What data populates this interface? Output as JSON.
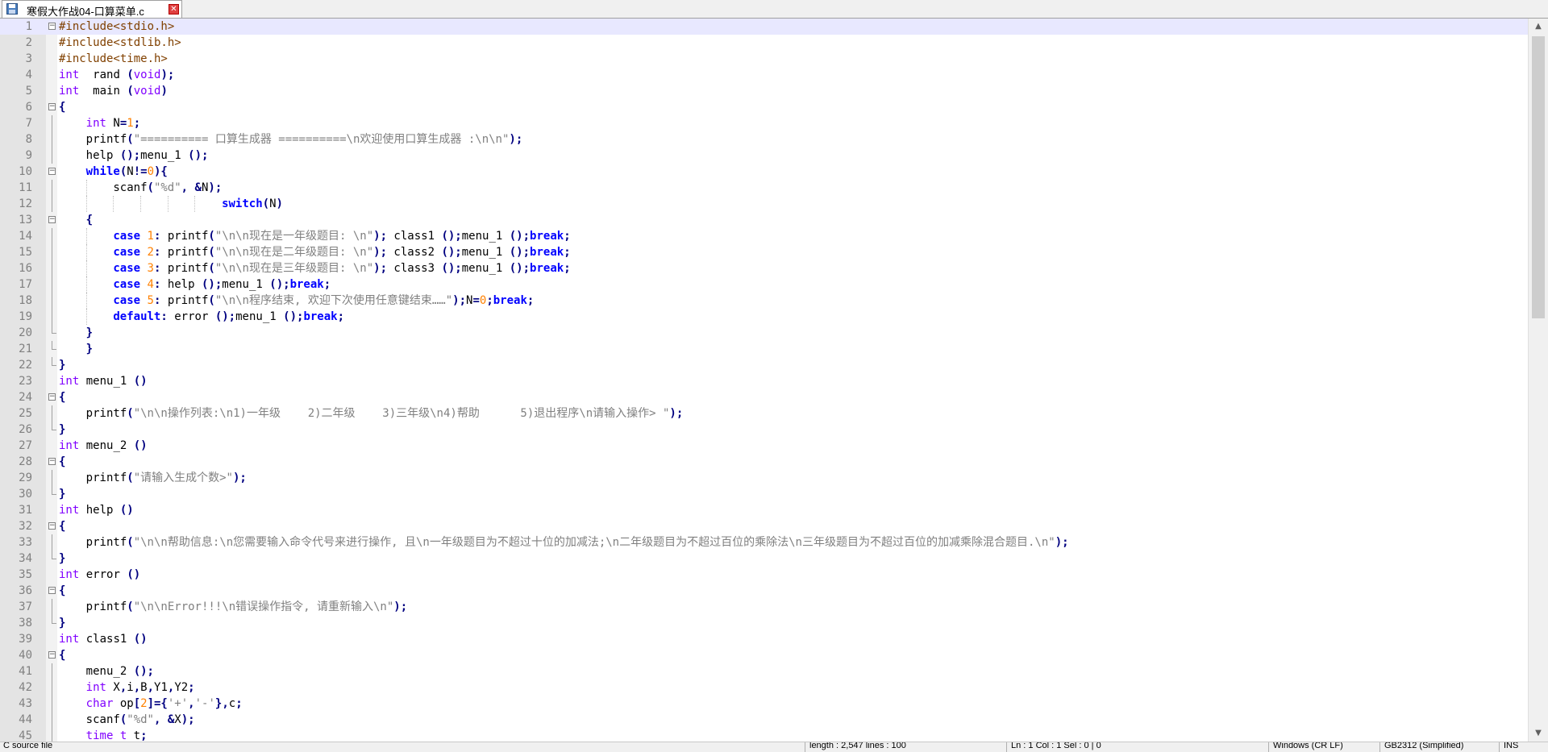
{
  "tab": {
    "title": "寒假大作战04-口算菜单.c",
    "save_icon": "floppy-disk-icon",
    "close_icon": "close-icon",
    "close_glyph": "✕"
  },
  "editor": {
    "current_line": 1,
    "lines": [
      {
        "n": "1",
        "indent": 0,
        "fold": "box",
        "foldFlow": "",
        "segs": [
          [
            "pp",
            "#include<stdio.h>"
          ]
        ]
      },
      {
        "n": "2",
        "indent": 0,
        "fold": "",
        "foldFlow": "",
        "segs": [
          [
            "pp",
            "#include<stdlib.h>"
          ]
        ]
      },
      {
        "n": "3",
        "indent": 0,
        "fold": "",
        "foldFlow": "",
        "segs": [
          [
            "pp",
            "#include<time.h>"
          ]
        ]
      },
      {
        "n": "4",
        "indent": 0,
        "fold": "",
        "foldFlow": "",
        "segs": [
          [
            "ty",
            "int"
          ],
          [
            "",
            "  rand "
          ],
          [
            "op",
            "("
          ],
          [
            "ty",
            "void"
          ],
          [
            "op",
            ");"
          ]
        ]
      },
      {
        "n": "5",
        "indent": 0,
        "fold": "",
        "foldFlow": "",
        "segs": [
          [
            "ty",
            "int"
          ],
          [
            "",
            "  main "
          ],
          [
            "op",
            "("
          ],
          [
            "ty",
            "void"
          ],
          [
            "op",
            ")"
          ]
        ]
      },
      {
        "n": "6",
        "indent": 0,
        "fold": "box",
        "foldFlow": "",
        "segs": [
          [
            "op",
            "{"
          ]
        ]
      },
      {
        "n": "7",
        "indent": 1,
        "fold": "",
        "foldFlow": "v",
        "segs": [
          [
            "ty",
            "int"
          ],
          [
            "",
            " N"
          ],
          [
            "op",
            "="
          ],
          [
            "nm",
            "1"
          ],
          [
            "op",
            ";"
          ]
        ]
      },
      {
        "n": "8",
        "indent": 1,
        "fold": "",
        "foldFlow": "v",
        "segs": [
          [
            "",
            "printf"
          ],
          [
            "op",
            "("
          ],
          [
            "st",
            "\"========== 口算生成器 ==========\\n欢迎使用口算生成器 :\\n\\n\""
          ],
          [
            "op",
            ");"
          ]
        ]
      },
      {
        "n": "9",
        "indent": 1,
        "fold": "",
        "foldFlow": "v",
        "segs": [
          [
            "",
            "help "
          ],
          [
            "op",
            "();"
          ],
          [
            "",
            "menu_1 "
          ],
          [
            "op",
            "();"
          ]
        ]
      },
      {
        "n": "10",
        "indent": 1,
        "fold": "box",
        "foldFlow": "",
        "segs": [
          [
            "kw",
            "while"
          ],
          [
            "op",
            "("
          ],
          [
            "",
            "N"
          ],
          [
            "op",
            "!="
          ],
          [
            "nm",
            "0"
          ],
          [
            "op",
            "){"
          ]
        ]
      },
      {
        "n": "11",
        "indent": 2,
        "fold": "",
        "foldFlow": "v",
        "segs": [
          [
            "",
            "scanf"
          ],
          [
            "op",
            "("
          ],
          [
            "st",
            "\"%d\""
          ],
          [
            "op",
            ", &"
          ],
          [
            "",
            "N"
          ],
          [
            "op",
            ");"
          ]
        ]
      },
      {
        "n": "12",
        "indent": 6,
        "fold": "",
        "foldFlow": "v",
        "segs": [
          [
            "kw",
            "switch"
          ],
          [
            "op",
            "("
          ],
          [
            "",
            "N"
          ],
          [
            "op",
            ")"
          ]
        ]
      },
      {
        "n": "13",
        "indent": 1,
        "fold": "box",
        "foldFlow": "",
        "segs": [
          [
            "op",
            "{"
          ]
        ]
      },
      {
        "n": "14",
        "indent": 2,
        "fold": "",
        "foldFlow": "v",
        "segs": [
          [
            "kw",
            "case"
          ],
          [
            "",
            " "
          ],
          [
            "nm",
            "1"
          ],
          [
            "op",
            ":"
          ],
          [
            "",
            " printf"
          ],
          [
            "op",
            "("
          ],
          [
            "st",
            "\"\\n\\n现在是一年级题目: \\n\""
          ],
          [
            "op",
            ");"
          ],
          [
            "",
            " class1 "
          ],
          [
            "op",
            "();"
          ],
          [
            "",
            "menu_1 "
          ],
          [
            "op",
            "();"
          ],
          [
            "kw",
            "break"
          ],
          [
            "op",
            ";"
          ]
        ]
      },
      {
        "n": "15",
        "indent": 2,
        "fold": "",
        "foldFlow": "v",
        "segs": [
          [
            "kw",
            "case"
          ],
          [
            "",
            " "
          ],
          [
            "nm",
            "2"
          ],
          [
            "op",
            ":"
          ],
          [
            "",
            " printf"
          ],
          [
            "op",
            "("
          ],
          [
            "st",
            "\"\\n\\n现在是二年级题目: \\n\""
          ],
          [
            "op",
            ");"
          ],
          [
            "",
            " class2 "
          ],
          [
            "op",
            "();"
          ],
          [
            "",
            "menu_1 "
          ],
          [
            "op",
            "();"
          ],
          [
            "kw",
            "break"
          ],
          [
            "op",
            ";"
          ]
        ]
      },
      {
        "n": "16",
        "indent": 2,
        "fold": "",
        "foldFlow": "v",
        "segs": [
          [
            "kw",
            "case"
          ],
          [
            "",
            " "
          ],
          [
            "nm",
            "3"
          ],
          [
            "op",
            ":"
          ],
          [
            "",
            " printf"
          ],
          [
            "op",
            "("
          ],
          [
            "st",
            "\"\\n\\n现在是三年级题目: \\n\""
          ],
          [
            "op",
            ");"
          ],
          [
            "",
            " class3 "
          ],
          [
            "op",
            "();"
          ],
          [
            "",
            "menu_1 "
          ],
          [
            "op",
            "();"
          ],
          [
            "kw",
            "break"
          ],
          [
            "op",
            ";"
          ]
        ]
      },
      {
        "n": "17",
        "indent": 2,
        "fold": "",
        "foldFlow": "v",
        "segs": [
          [
            "kw",
            "case"
          ],
          [
            "",
            " "
          ],
          [
            "nm",
            "4"
          ],
          [
            "op",
            ":"
          ],
          [
            "",
            " help "
          ],
          [
            "op",
            "();"
          ],
          [
            "",
            "menu_1 "
          ],
          [
            "op",
            "();"
          ],
          [
            "kw",
            "break"
          ],
          [
            "op",
            ";"
          ]
        ]
      },
      {
        "n": "18",
        "indent": 2,
        "fold": "",
        "foldFlow": "v",
        "segs": [
          [
            "kw",
            "case"
          ],
          [
            "",
            " "
          ],
          [
            "nm",
            "5"
          ],
          [
            "op",
            ":"
          ],
          [
            "",
            " printf"
          ],
          [
            "op",
            "("
          ],
          [
            "st",
            "\"\\n\\n程序结束, 欢迎下次使用任意键结束……\""
          ],
          [
            "op",
            ");"
          ],
          [
            "",
            "N"
          ],
          [
            "op",
            "="
          ],
          [
            "nm",
            "0"
          ],
          [
            "op",
            ";"
          ],
          [
            "kw",
            "break"
          ],
          [
            "op",
            ";"
          ]
        ]
      },
      {
        "n": "19",
        "indent": 2,
        "fold": "",
        "foldFlow": "v",
        "segs": [
          [
            "kw",
            "default"
          ],
          [
            "op",
            ":"
          ],
          [
            "",
            " error "
          ],
          [
            "op",
            "();"
          ],
          [
            "",
            "menu_1 "
          ],
          [
            "op",
            "();"
          ],
          [
            "kw",
            "break"
          ],
          [
            "op",
            ";"
          ]
        ]
      },
      {
        "n": "20",
        "indent": 1,
        "fold": "",
        "foldFlow": "end",
        "segs": [
          [
            "op",
            "}"
          ]
        ]
      },
      {
        "n": "21",
        "indent": 1,
        "fold": "",
        "foldFlow": "end",
        "segs": [
          [
            "op",
            "}"
          ]
        ]
      },
      {
        "n": "22",
        "indent": 0,
        "fold": "",
        "foldFlow": "end",
        "segs": [
          [
            "op",
            "}"
          ]
        ]
      },
      {
        "n": "23",
        "indent": 0,
        "fold": "",
        "foldFlow": "",
        "segs": [
          [
            "ty",
            "int"
          ],
          [
            "",
            " menu_1 "
          ],
          [
            "op",
            "()"
          ]
        ]
      },
      {
        "n": "24",
        "indent": 0,
        "fold": "box",
        "foldFlow": "",
        "segs": [
          [
            "op",
            "{"
          ]
        ]
      },
      {
        "n": "25",
        "indent": 1,
        "fold": "",
        "foldFlow": "v",
        "segs": [
          [
            "",
            "printf"
          ],
          [
            "op",
            "("
          ],
          [
            "st",
            "\"\\n\\n操作列表:\\n1)一年级    2)二年级    3)三年级\\n4)帮助      5)退出程序\\n请输入操作> \""
          ],
          [
            "op",
            ");"
          ]
        ]
      },
      {
        "n": "26",
        "indent": 0,
        "fold": "",
        "foldFlow": "end",
        "segs": [
          [
            "op",
            "}"
          ]
        ]
      },
      {
        "n": "27",
        "indent": 0,
        "fold": "",
        "foldFlow": "",
        "segs": [
          [
            "ty",
            "int"
          ],
          [
            "",
            " menu_2 "
          ],
          [
            "op",
            "()"
          ]
        ]
      },
      {
        "n": "28",
        "indent": 0,
        "fold": "box",
        "foldFlow": "",
        "segs": [
          [
            "op",
            "{"
          ]
        ]
      },
      {
        "n": "29",
        "indent": 1,
        "fold": "",
        "foldFlow": "v",
        "segs": [
          [
            "",
            "printf"
          ],
          [
            "op",
            "("
          ],
          [
            "st",
            "\"请输入生成个数>\""
          ],
          [
            "op",
            ");"
          ]
        ]
      },
      {
        "n": "30",
        "indent": 0,
        "fold": "",
        "foldFlow": "end",
        "segs": [
          [
            "op",
            "}"
          ]
        ]
      },
      {
        "n": "31",
        "indent": 0,
        "fold": "",
        "foldFlow": "",
        "segs": [
          [
            "ty",
            "int"
          ],
          [
            "",
            " help "
          ],
          [
            "op",
            "()"
          ]
        ]
      },
      {
        "n": "32",
        "indent": 0,
        "fold": "box",
        "foldFlow": "",
        "segs": [
          [
            "op",
            "{"
          ]
        ]
      },
      {
        "n": "33",
        "indent": 1,
        "fold": "",
        "foldFlow": "v",
        "segs": [
          [
            "",
            "printf"
          ],
          [
            "op",
            "("
          ],
          [
            "st",
            "\"\\n\\n帮助信息:\\n您需要输入命令代号来进行操作, 且\\n一年级题目为不超过十位的加减法;\\n二年级题目为不超过百位的乘除法\\n三年级题目为不超过百位的加减乘除混合题目.\\n\""
          ],
          [
            "op",
            ");"
          ]
        ]
      },
      {
        "n": "34",
        "indent": 0,
        "fold": "",
        "foldFlow": "end",
        "segs": [
          [
            "op",
            "}"
          ]
        ]
      },
      {
        "n": "35",
        "indent": 0,
        "fold": "",
        "foldFlow": "",
        "segs": [
          [
            "ty",
            "int"
          ],
          [
            "",
            " error "
          ],
          [
            "op",
            "()"
          ]
        ]
      },
      {
        "n": "36",
        "indent": 0,
        "fold": "box",
        "foldFlow": "",
        "segs": [
          [
            "op",
            "{"
          ]
        ]
      },
      {
        "n": "37",
        "indent": 1,
        "fold": "",
        "foldFlow": "v",
        "segs": [
          [
            "",
            "printf"
          ],
          [
            "op",
            "("
          ],
          [
            "st",
            "\"\\n\\nError!!!\\n错误操作指令, 请重新输入\\n\""
          ],
          [
            "op",
            ");"
          ]
        ]
      },
      {
        "n": "38",
        "indent": 0,
        "fold": "",
        "foldFlow": "end",
        "segs": [
          [
            "op",
            "}"
          ]
        ]
      },
      {
        "n": "39",
        "indent": 0,
        "fold": "",
        "foldFlow": "",
        "segs": [
          [
            "ty",
            "int"
          ],
          [
            "",
            " class1 "
          ],
          [
            "op",
            "()"
          ]
        ]
      },
      {
        "n": "40",
        "indent": 0,
        "fold": "box",
        "foldFlow": "",
        "segs": [
          [
            "op",
            "{"
          ]
        ]
      },
      {
        "n": "41",
        "indent": 1,
        "fold": "",
        "foldFlow": "v",
        "segs": [
          [
            "",
            "menu_2 "
          ],
          [
            "op",
            "();"
          ]
        ]
      },
      {
        "n": "42",
        "indent": 1,
        "fold": "",
        "foldFlow": "v",
        "segs": [
          [
            "ty",
            "int"
          ],
          [
            "",
            " X"
          ],
          [
            "op",
            ","
          ],
          [
            "",
            "i"
          ],
          [
            "op",
            ","
          ],
          [
            "",
            "B"
          ],
          [
            "op",
            ","
          ],
          [
            "",
            "Y1"
          ],
          [
            "op",
            ","
          ],
          [
            "",
            "Y2"
          ],
          [
            "op",
            ";"
          ]
        ]
      },
      {
        "n": "43",
        "indent": 1,
        "fold": "",
        "foldFlow": "v",
        "segs": [
          [
            "ty",
            "char"
          ],
          [
            "",
            " op"
          ],
          [
            "op",
            "["
          ],
          [
            "nm",
            "2"
          ],
          [
            "op",
            "]={"
          ],
          [
            "st",
            "'+'"
          ],
          [
            "op",
            ","
          ],
          [
            "st",
            "'-'"
          ],
          [
            "op",
            "},"
          ],
          [
            "",
            "c"
          ],
          [
            "op",
            ";"
          ]
        ]
      },
      {
        "n": "44",
        "indent": 1,
        "fold": "",
        "foldFlow": "v",
        "segs": [
          [
            "",
            "scanf"
          ],
          [
            "op",
            "("
          ],
          [
            "st",
            "\"%d\""
          ],
          [
            "op",
            ", &"
          ],
          [
            "",
            "X"
          ],
          [
            "op",
            ");"
          ]
        ]
      },
      {
        "n": "45",
        "indent": 1,
        "fold": "",
        "foldFlow": "v",
        "segs": [
          [
            "ty",
            "time_t"
          ],
          [
            "",
            " t"
          ],
          [
            "op",
            ";"
          ]
        ]
      }
    ]
  },
  "scrollbar": {
    "up_glyph": "▲",
    "down_glyph": "▼"
  },
  "statusbar": {
    "file_type": "C source file",
    "length": "length : 2,547    lines : 100",
    "position": "Ln : 1    Col : 1    Sel : 0 | 0",
    "eol": "Windows (CR LF)",
    "encoding": "GB2312 (Simplified)",
    "mode": "INS"
  }
}
